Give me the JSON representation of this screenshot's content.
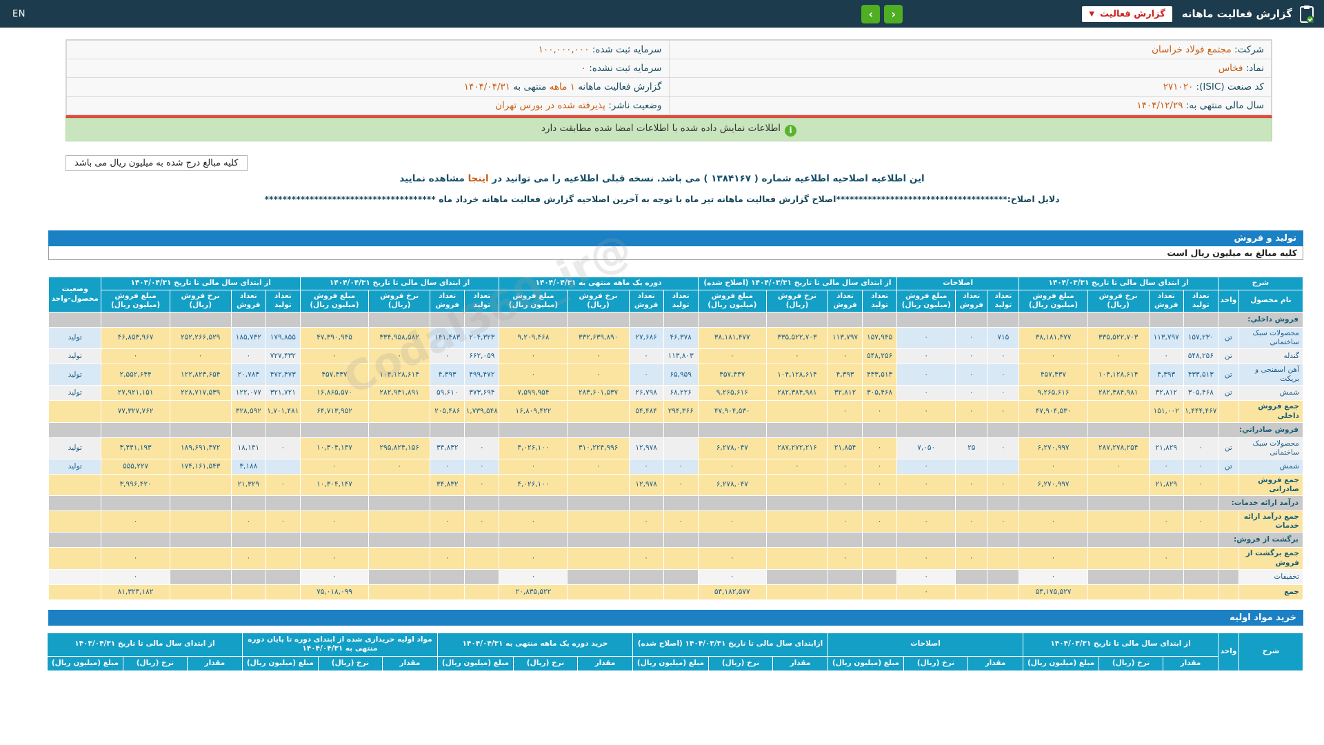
{
  "topbar": {
    "title": "گزارش فعالیت ماهانه",
    "dropdown_label": "گزارش فعالیت",
    "dropdown_caret": "▼",
    "prev_icon": "‹",
    "next_icon": "›",
    "lang": "EN"
  },
  "info": {
    "rows": [
      {
        "right": [
          {
            "t": "شرکت:  ",
            "hl": false
          },
          {
            "t": "مجتمع فولاد خراسان",
            "hl": true
          }
        ],
        "left": [
          {
            "t": "سرمایه ثبت شده:  ",
            "hl": false
          },
          {
            "t": "۱۰۰,۰۰۰,۰۰۰",
            "hl": true
          }
        ]
      },
      {
        "right": [
          {
            "t": "نماد:  ",
            "hl": false
          },
          {
            "t": "فخاس",
            "hl": true
          }
        ],
        "left": [
          {
            "t": "سرمایه ثبت نشده:  ",
            "hl": false
          },
          {
            "t": "۰",
            "hl": true
          }
        ]
      },
      {
        "right": [
          {
            "t": "کد صنعت (ISIC):  ",
            "hl": false
          },
          {
            "t": "۲۷۱۰۲۰",
            "hl": true
          }
        ],
        "left": [
          {
            "t": "گزارش فعالیت ماهانه ",
            "hl": false
          },
          {
            "t": "۱ ماهه",
            "hl": true
          },
          {
            "t": " منتهی به ",
            "hl": false
          },
          {
            "t": "۱۴۰۴/۰۴/۳۱",
            "hl": true
          }
        ]
      },
      {
        "right": [
          {
            "t": "سال مالی منتهی به:  ",
            "hl": false
          },
          {
            "t": "۱۴۰۴/۱۲/۲۹",
            "hl": true
          }
        ],
        "left": [
          {
            "t": "وضعیت ناشر:  ",
            "hl": false
          },
          {
            "t": "پذیرفته شده در بورس تهران",
            "hl": true
          }
        ]
      }
    ]
  },
  "notice": {
    "icon": "i",
    "text": "اطلاعات نمایش داده شده با اطلاعات امضا شده مطابقت دارد"
  },
  "note_box": "کلیه مبالغ درج شده به میلیون ریال می باشد",
  "revision_line": {
    "before": "این اطلاعیه اصلاحیه اطلاعیه شماره ( ۱۳۸۴۱۶۷ ) می باشد. نسخه قبلی اطلاعیه را می توانید در ",
    "link": "اینجا",
    "after": " مشاهده نمایید"
  },
  "reasons_line": "دلایل اصلاح:**************************************اصلاح گزارش فعالیت ماهانه تیر ماه با توجه به آخرین اصلاحیه گزارش فعالیت ماهانه خرداد ماه **************************************",
  "watermark": "@Codal360_ir",
  "sales_section": {
    "bar": "تولید و فروش",
    "unit_note": "کلیه مبالغ به میلیون ریال است",
    "table": {
      "sharh": "شرح",
      "name_col": "نام محصول",
      "unit_col": "واحد",
      "status_col": "وضعیت محصول-واحد",
      "groups": [
        {
          "title": "از ابتدای سال مالی تا تاریخ ۱۴۰۴/۰۳/۳۱",
          "cols": [
            "تعداد تولید",
            "تعداد فروش",
            "نرخ فروش (ریال)",
            "مبلغ فروش (میلیون ریال)"
          ]
        },
        {
          "title": "اصلاحات",
          "cols": [
            "تعداد تولید",
            "تعداد فروش",
            "مبلغ فروش (میلیون ریال)"
          ]
        },
        {
          "title": "از ابتدای سال مالی تا تاریخ ۱۴۰۴/۰۳/۳۱ (اصلاح شده)",
          "cols": [
            "تعداد تولید",
            "تعداد فروش",
            "نرخ فروش (ریال)",
            "مبلغ فروش (میلیون ریال)"
          ]
        },
        {
          "title": "دوره یک ماهه منتهی به ۱۴۰۴/۰۴/۳۱",
          "cols": [
            "تعداد تولید",
            "تعداد فروش",
            "نرخ فروش (ریال)",
            "مبلغ فروش (میلیون ریال)"
          ]
        },
        {
          "title": "از ابتدای سال مالی تا تاریخ ۱۴۰۴/۰۴/۳۱",
          "cols": [
            "تعداد تولید",
            "تعداد فروش",
            "نرخ فروش (ریال)",
            "مبلغ فروش (میلیون ریال)"
          ]
        },
        {
          "title": "از ابتدای سال مالی تا تاریخ ۱۴۰۳/۰۴/۳۱",
          "cols": [
            "تعداد تولید",
            "تعداد فروش",
            "نرخ فروش (ریال)",
            "مبلغ فروش (میلیون ریال)"
          ]
        }
      ],
      "rows": [
        {
          "type": "section",
          "label": "فروش داخلي:"
        },
        {
          "type": "data",
          "shade": "rb",
          "name": "محصولات سبک ساختمانی",
          "unit": "تن",
          "status": "تولید",
          "cells": [
            "۱۵۷,۲۳۰",
            "۱۱۳,۷۹۷",
            "۳۳۵,۵۲۲,۷۰۳",
            "۳۸,۱۸۱,۴۷۷",
            "۷۱۵",
            "۰",
            "۰",
            "۱۵۷,۹۴۵",
            "۱۱۳,۷۹۷",
            "۳۳۵,۵۲۲,۷۰۳",
            "۳۸,۱۸۱,۴۷۷",
            "۴۶,۳۷۸",
            "۲۷,۶۸۶",
            "۳۳۲,۶۳۹,۸۹۰",
            "۹,۲۰۹,۴۶۸",
            "۲۰۴,۳۲۳",
            "۱۴۱,۴۸۳",
            "۳۳۴,۹۵۸,۵۸۲",
            "۴۷,۳۹۰,۹۴۵",
            "۱۷۹,۸۵۵",
            "۱۸۵,۷۳۲",
            "۲۵۲,۲۶۶,۵۲۹",
            "۴۶,۸۵۳,۹۶۷"
          ]
        },
        {
          "type": "data",
          "shade": "rw",
          "name": "گندله",
          "unit": "تن",
          "status": "تولید",
          "cells": [
            "۵۴۸,۲۵۶",
            "۰",
            "۰",
            "۰",
            "۰",
            "۰",
            "۰",
            "۵۴۸,۲۵۶",
            "۰",
            "۰",
            "۰",
            "۱۱۳,۸۰۳",
            "۰",
            "۰",
            "۰",
            "۶۶۲,۰۵۹",
            "۰",
            "۰",
            "۰",
            "۷۲۷,۴۳۲",
            "۰",
            "۰",
            "۰"
          ]
        },
        {
          "type": "data",
          "shade": "rb",
          "name": "آهن اسفنجی و بریکت",
          "unit": "تن",
          "status": "تولید",
          "cells": [
            "۴۳۳,۵۱۳",
            "۴,۳۹۳",
            "۱۰۴,۱۲۸,۶۱۴",
            "۴۵۷,۴۳۷",
            "۰",
            "۰",
            "۰",
            "۴۳۳,۵۱۳",
            "۴,۳۹۳",
            "۱۰۴,۱۲۸,۶۱۴",
            "۴۵۷,۴۳۷",
            "۶۵,۹۵۹",
            "۰",
            "۰",
            "۰",
            "۴۹۹,۴۷۲",
            "۴,۳۹۳",
            "۱۰۴,۱۲۸,۶۱۴",
            "۴۵۷,۴۳۷",
            "۴۷۲,۴۷۳",
            "۲۰,۷۸۳",
            "۱۲۲,۸۲۳,۶۵۴",
            "۲,۵۵۲,۶۴۴"
          ]
        },
        {
          "type": "data",
          "shade": "rw",
          "name": "شمش",
          "unit": "تن",
          "status": "تولید",
          "cells": [
            "۳۰۵,۴۶۸",
            "۳۲,۸۱۲",
            "۲۸۲,۳۸۴,۹۸۱",
            "۹,۲۶۵,۶۱۶",
            "۰",
            "۰",
            "۰",
            "۳۰۵,۴۶۸",
            "۳۲,۸۱۲",
            "۲۸۲,۳۸۴,۹۸۱",
            "۹,۲۶۵,۶۱۶",
            "۶۸,۲۲۶",
            "۲۶,۷۹۸",
            "۲۸۳,۶۰۱,۵۳۷",
            "۷,۵۹۹,۹۵۴",
            "۳۷۳,۶۹۴",
            "۵۹,۶۱۰",
            "۲۸۲,۹۳۱,۸۹۱",
            "۱۶,۸۶۵,۵۷۰",
            "۳۲۱,۷۲۱",
            "۱۲۲,۰۷۷",
            "۲۲۸,۷۱۷,۵۳۹",
            "۲۷,۹۲۱,۱۵۱"
          ]
        },
        {
          "type": "total",
          "name": "جمع فروش داخلی",
          "unit": "",
          "status": "",
          "cells": [
            "۱,۴۴۴,۴۶۷",
            "۱۵۱,۰۰۲",
            "",
            "۴۷,۹۰۴,۵۳۰",
            "۰",
            "۰",
            "۰",
            "۰",
            "۰",
            "",
            "۴۷,۹۰۴,۵۳۰",
            "۲۹۴,۳۶۶",
            "۵۴,۴۸۴",
            "",
            "۱۶,۸۰۹,۴۲۲",
            "۱,۷۳۹,۵۴۸",
            "۲۰۵,۴۸۶",
            "",
            "۶۴,۷۱۳,۹۵۲",
            "۱,۷۰۱,۴۸۱",
            "۳۲۸,۵۹۲",
            "",
            "۷۷,۳۲۷,۷۶۲"
          ]
        },
        {
          "type": "section",
          "label": "فروش صادراتي:"
        },
        {
          "type": "data",
          "shade": "rw",
          "name": "محصولات سبک ساختمانی",
          "unit": "تن",
          "status": "تولید",
          "cells": [
            "۰",
            "۲۱,۸۲۹",
            "۲۸۷,۲۷۸,۲۵۴",
            "۶,۲۷۰,۹۹۷",
            "۰",
            "۲۵",
            "۷,۰۵۰",
            "۰",
            "۲۱,۸۵۴",
            "۲۸۷,۲۷۲,۲۱۶",
            "۶,۲۷۸,۰۴۷",
            "",
            "۱۲,۹۷۸",
            "۳۱۰,۲۲۴,۹۹۶",
            "۴,۰۲۶,۱۰۰",
            "۰",
            "۳۴,۸۳۲",
            "۲۹۵,۸۲۴,۱۵۶",
            "۱۰,۳۰۴,۱۴۷",
            "۰",
            "۱۸,۱۴۱",
            "۱۸۹,۶۹۱,۴۷۲",
            "۳,۴۴۱,۱۹۳"
          ]
        },
        {
          "type": "data",
          "shade": "rb",
          "name": "شمش",
          "unit": "تن",
          "status": "تولید",
          "cells": [
            "۰",
            "۰",
            "۰",
            "۰",
            "",
            "",
            "۰",
            "۰",
            "۰",
            "۰",
            "۰",
            "۰",
            "۰",
            "۰",
            "۰",
            "۰",
            "۰",
            "۰",
            "۰",
            "",
            "۳,۱۸۸",
            "۱۷۴,۱۶۱,۵۴۳",
            "۵۵۵,۲۲۷"
          ]
        },
        {
          "type": "total",
          "name": "جمع فروش صادراتی",
          "unit": "",
          "status": "",
          "cells": [
            "۰",
            "۲۱,۸۲۹",
            "",
            "۶,۲۷۰,۹۹۷",
            "۰",
            "۰",
            "۰",
            "۰",
            "۰",
            "",
            "۶,۲۷۸,۰۴۷",
            "۰",
            "۱۲,۹۷۸",
            "",
            "۴,۰۲۶,۱۰۰",
            "۰",
            "۳۴,۸۳۲",
            "",
            "۱۰,۳۰۴,۱۴۷",
            "۰",
            "۲۱,۳۲۹",
            "",
            "۳,۹۹۶,۴۲۰"
          ]
        },
        {
          "type": "section",
          "label": "درآمد ارائه خدمات:"
        },
        {
          "type": "total",
          "name": "جمع درآمد ارائه خدمات",
          "unit": "",
          "status": "",
          "cells": [
            "۰",
            "۰",
            "",
            "۰",
            "۰",
            "۰",
            "۰",
            "۰",
            "۰",
            "",
            "۰",
            "۰",
            "۰",
            "",
            "۰",
            "۰",
            "۰",
            "",
            "۰",
            "۰",
            "۰",
            "",
            "۰"
          ]
        },
        {
          "type": "section",
          "label": "برگشت از فروش:"
        },
        {
          "type": "total",
          "name": "جمع برگشت از فروش",
          "unit": "",
          "status": "",
          "cells": [
            "",
            "۰",
            "",
            "۰",
            "",
            "۰",
            "۰",
            "",
            "۰",
            "",
            "۰",
            "",
            "۰",
            "",
            "۰",
            "",
            "۰",
            "",
            "۰",
            "",
            "۰",
            "",
            "۰"
          ]
        },
        {
          "type": "disc",
          "name": "تخفیفات",
          "unit": "",
          "status": "",
          "cells": [
            "",
            "",
            "",
            "۰",
            "",
            "",
            "۰",
            "",
            "",
            "",
            "۰",
            "",
            "",
            "",
            "۰",
            "",
            "",
            "",
            "۰",
            "",
            "",
            "",
            "۰"
          ]
        },
        {
          "type": "total",
          "name": "جمع",
          "unit": "",
          "status": "",
          "cells": [
            "",
            "",
            "",
            "۵۴,۱۷۵,۵۲۷",
            "",
            "",
            "۰",
            "",
            "",
            "",
            "۵۴,۱۸۲,۵۷۷",
            "",
            "",
            "",
            "۲۰,۸۳۵,۵۲۲",
            "",
            "",
            "",
            "۷۵,۰۱۸,۰۹۹",
            "",
            "",
            "",
            "۸۱,۳۲۴,۱۸۲"
          ]
        }
      ]
    }
  },
  "purchase_section": {
    "bar": "خرید مواد اولیه",
    "table": {
      "sharh": "شرح",
      "unit_col": "واحد",
      "sub_cols": [
        "مقدار",
        "نرخ (ریال)",
        "مبلغ (میلیون ریال)"
      ],
      "groups": [
        "از ابتدای سال مالی تا تاریخ ۱۴۰۴/۰۳/۳۱",
        "اصلاحات",
        "ازابتدای سال مالی تا تاریخ ۱۴۰۴/۰۳/۳۱ (اصلاح شده)",
        "خرید دوره یک ماهه منتهی به ۱۴۰۴/۰۴/۳۱",
        "مواد اولیه خریداری شده از ابتدای دوره تا پایان دوره منتهی به ۱۴۰۴/۰۴/۳۱",
        "از ابتدای سال مالی تا تاریخ ۱۴۰۳/۰۴/۳۱"
      ]
    }
  }
}
